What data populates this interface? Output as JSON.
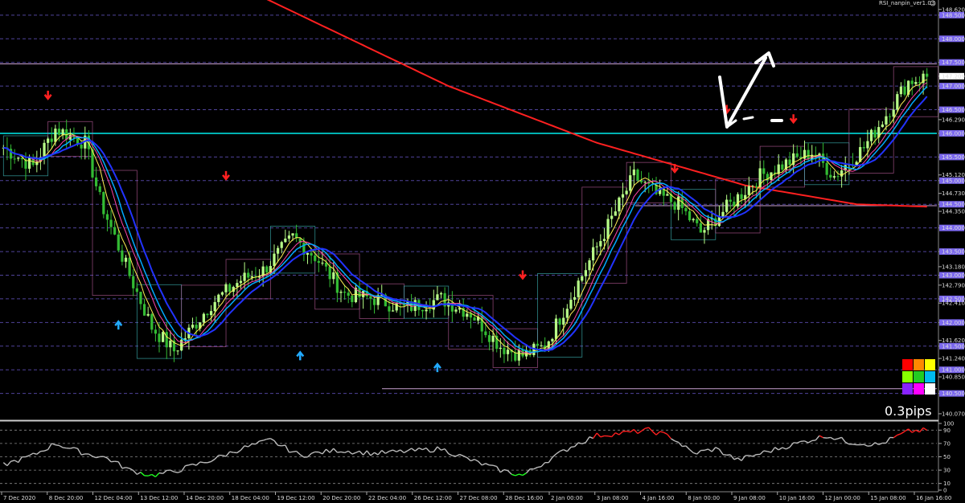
{
  "chart_data": {
    "type": "candlestick",
    "indicator_name": "RSI_nanpin_ver1.03",
    "spread_label": "0.3pips",
    "current_price": "147.209",
    "price_axis": {
      "ylim": [
        139.95,
        148.82
      ],
      "ticks": [
        "148.620",
        "148.500",
        "148.000",
        "147.500",
        "147.209",
        "147.000",
        "146.500",
        "146.290",
        "146.000",
        "145.500",
        "145.120",
        "145.000",
        "144.730",
        "144.500",
        "144.350",
        "144.000",
        "143.500",
        "143.180",
        "143.000",
        "142.790",
        "142.500",
        "142.410",
        "142.000",
        "141.620",
        "141.500",
        "141.240",
        "141.000",
        "140.850",
        "140.500",
        "140.070"
      ],
      "highlighted": [
        "148.500",
        "148.000",
        "147.500",
        "147.000",
        "146.500",
        "146.000",
        "145.500",
        "145.000",
        "144.500",
        "144.000",
        "143.500",
        "143.000",
        "142.500",
        "142.000",
        "141.500",
        "141.000",
        "140.500"
      ]
    },
    "rsi_axis": {
      "ylim": [
        0,
        100
      ],
      "ticks": [
        "100",
        "90",
        "70",
        "50",
        "30",
        "10",
        "0"
      ],
      "levels": [
        90,
        70,
        50,
        30,
        10
      ]
    },
    "time_labels": [
      "7 Dec 2020",
      "8 Dec 20:00",
      "12 Dec 04:00",
      "13 Dec 12:00",
      "14 Dec 20:00",
      "18 Dec 04:00",
      "19 Dec 12:00",
      "20 Dec 20:00",
      "22 Dec 04:00",
      "26 Dec 12:00",
      "27 Dec 08:00",
      "28 Dec 16:00",
      "2 Jan 00:00",
      "3 Jan 08:00",
      "4 Jan 16:00",
      "8 Jan 00:00",
      "9 Jan 08:00",
      "10 Jan 16:00",
      "12 Jan 00:00",
      "15 Jan 08:00",
      "16 Jan 16:00"
    ],
    "key_points": [
      [
        0,
        145.7
      ],
      [
        8,
        145.3
      ],
      [
        14,
        146.1
      ],
      [
        22,
        145.8
      ],
      [
        26,
        144.6
      ],
      [
        34,
        143.0
      ],
      [
        40,
        141.9
      ],
      [
        46,
        141.4
      ],
      [
        56,
        142.4
      ],
      [
        64,
        142.9
      ],
      [
        70,
        143.1
      ],
      [
        78,
        143.8
      ],
      [
        84,
        143.4
      ],
      [
        92,
        142.6
      ],
      [
        100,
        142.5
      ],
      [
        108,
        142.3
      ],
      [
        118,
        142.5
      ],
      [
        126,
        142.2
      ],
      [
        134,
        141.5
      ],
      [
        140,
        141.3
      ],
      [
        146,
        141.5
      ],
      [
        154,
        142.7
      ],
      [
        162,
        143.9
      ],
      [
        170,
        145.1
      ],
      [
        176,
        144.7
      ],
      [
        182,
        144.5
      ],
      [
        188,
        143.9
      ],
      [
        196,
        144.5
      ],
      [
        204,
        145.1
      ],
      [
        212,
        145.4
      ],
      [
        218,
        145.6
      ],
      [
        224,
        145.1
      ],
      [
        232,
        145.7
      ],
      [
        238,
        146.4
      ],
      [
        244,
        147.1
      ],
      [
        249,
        147.2
      ]
    ],
    "n_bars": 250,
    "ma_200_points": [
      [
        0,
        151.2
      ],
      [
        40,
        150.0
      ],
      [
        80,
        148.5
      ],
      [
        120,
        147.0
      ],
      [
        160,
        145.8
      ],
      [
        200,
        144.9
      ],
      [
        230,
        144.5
      ],
      [
        249,
        144.45
      ]
    ],
    "rsi_points": [
      [
        0,
        38
      ],
      [
        8,
        52
      ],
      [
        14,
        70
      ],
      [
        22,
        55
      ],
      [
        28,
        48
      ],
      [
        34,
        30
      ],
      [
        40,
        22
      ],
      [
        46,
        28
      ],
      [
        56,
        45
      ],
      [
        64,
        62
      ],
      [
        72,
        75
      ],
      [
        80,
        52
      ],
      [
        90,
        60
      ],
      [
        100,
        55
      ],
      [
        108,
        58
      ],
      [
        118,
        62
      ],
      [
        126,
        45
      ],
      [
        134,
        30
      ],
      [
        140,
        22
      ],
      [
        146,
        42
      ],
      [
        154,
        68
      ],
      [
        160,
        82
      ],
      [
        168,
        86
      ],
      [
        174,
        90
      ],
      [
        180,
        80
      ],
      [
        186,
        55
      ],
      [
        192,
        62
      ],
      [
        198,
        45
      ],
      [
        206,
        58
      ],
      [
        214,
        70
      ],
      [
        222,
        82
      ],
      [
        228,
        72
      ],
      [
        236,
        68
      ],
      [
        244,
        88
      ],
      [
        249,
        90
      ]
    ],
    "arrows_down": [
      [
        12,
        146.75
      ],
      [
        60,
        145.05
      ],
      [
        140,
        142.95
      ],
      [
        181,
        145.2
      ],
      [
        195,
        146.45
      ],
      [
        213,
        146.25
      ]
    ],
    "arrows_up": [
      [
        31,
        141.85
      ],
      [
        80,
        141.2
      ],
      [
        117,
        140.95
      ]
    ],
    "horizontal_levels": [
      147.47,
      146.0,
      144.47,
      140.6
    ],
    "color_grid": [
      "#ff0000",
      "#ff8800",
      "#ffff00",
      "#88ff00",
      "#22cc22",
      "#00bbee",
      "#8822ff",
      "#ff00ff",
      "#ffffff"
    ],
    "colors": {
      "background": "#000000",
      "bull_candle": "#b8ff88",
      "bear_candle": "#33bb33",
      "grid": "#6a5acd",
      "ma_200": "#ff2020",
      "fast_ma": "#00aaff",
      "slow_ma": "#2233ff",
      "rsi_normal": "#bbbbbb",
      "rsi_high": "#ff2020",
      "rsi_low": "#22ff22",
      "level_line": "#00eeee"
    }
  }
}
